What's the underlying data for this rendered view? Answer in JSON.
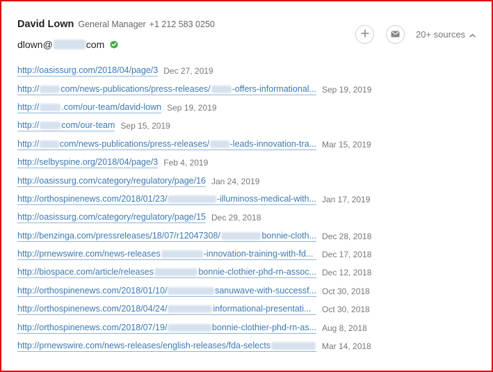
{
  "contact": {
    "name": "David Lown",
    "title": "General Manager",
    "phone": "+1 212 583 0250",
    "email_prefix": "dlown@",
    "email_suffix": "com"
  },
  "actions": {
    "sources_label": "20+ sources"
  },
  "colors": {
    "link": "#3b79b4",
    "verified": "#3bab3b",
    "frame": "#e30000"
  },
  "icons": {
    "add": "plus-icon",
    "email": "envelope-icon",
    "verified": "verified-check-icon",
    "collapse": "chevron-up-icon"
  },
  "sources": [
    {
      "url_parts": [
        "http://oasissurg.com/2018/04/page/3"
      ],
      "date": "Dec 27, 2019",
      "truncated": false
    },
    {
      "url_parts": [
        "http://",
        "com/news-publications/press-releases/",
        "-offers-informational..."
      ],
      "date": "Sep 19, 2019",
      "truncated": true
    },
    {
      "url_parts": [
        "http://",
        ".com/our-team/david-lown"
      ],
      "date": "Sep 19, 2019",
      "truncated": false
    },
    {
      "url_parts": [
        "http://",
        "com/our-team"
      ],
      "date": "Sep 15, 2019",
      "truncated": false
    },
    {
      "url_parts": [
        "http://",
        "com/news-publications/press-releases/",
        "-leads-innovation-tra..."
      ],
      "date": "Mar 15, 2019",
      "truncated": true
    },
    {
      "url_parts": [
        "http://selbyspine.org/2018/04/page/3"
      ],
      "date": "Feb 4, 2019",
      "truncated": false
    },
    {
      "url_parts": [
        "http://oasissurg.com/category/regulatory/page/16"
      ],
      "date": "Jan 24, 2019",
      "truncated": false
    },
    {
      "url_parts": [
        "http://orthospinenews.com/2018/01/23/",
        "-illuminoss-medical-with..."
      ],
      "date": "Jan 17, 2019",
      "truncated": true
    },
    {
      "url_parts": [
        "http://oasissurg.com/category/regulatory/page/15"
      ],
      "date": "Dec 29, 2018",
      "truncated": false
    },
    {
      "url_parts": [
        "http://benzinga.com/pressreleases/18/07/r12047308/",
        "bonnie-cloth..."
      ],
      "date": "Dec 28, 2018",
      "truncated": true
    },
    {
      "url_parts": [
        "http://prnewswire.com/news-releases",
        "-innovation-training-with-fd..."
      ],
      "date": "Dec 17, 2018",
      "truncated": true
    },
    {
      "url_parts": [
        "http://biospace.com/article/releases",
        "bonnie-clothier-phd-rn-assoc..."
      ],
      "date": "Dec 12, 2018",
      "truncated": true
    },
    {
      "url_parts": [
        "http://orthospinenews.com/2018/01/10/",
        "sanuwave-with-successf..."
      ],
      "date": "Oct 30, 2018",
      "truncated": true
    },
    {
      "url_parts": [
        "http://orthospinenews.com/2018/04/24/",
        "informational-presentati..."
      ],
      "date": "Oct 30, 2018",
      "truncated": true
    },
    {
      "url_parts": [
        "http://orthospinenews.com/2018/07/19/",
        "bonnie-clothier-phd-rn-as..."
      ],
      "date": "Aug 8, 2018",
      "truncated": true
    },
    {
      "url_parts": [
        "http://prnewswire.com/news-releases/english-releases/fda-selects",
        ""
      ],
      "date": "Mar 14, 2018",
      "truncated": true
    }
  ]
}
